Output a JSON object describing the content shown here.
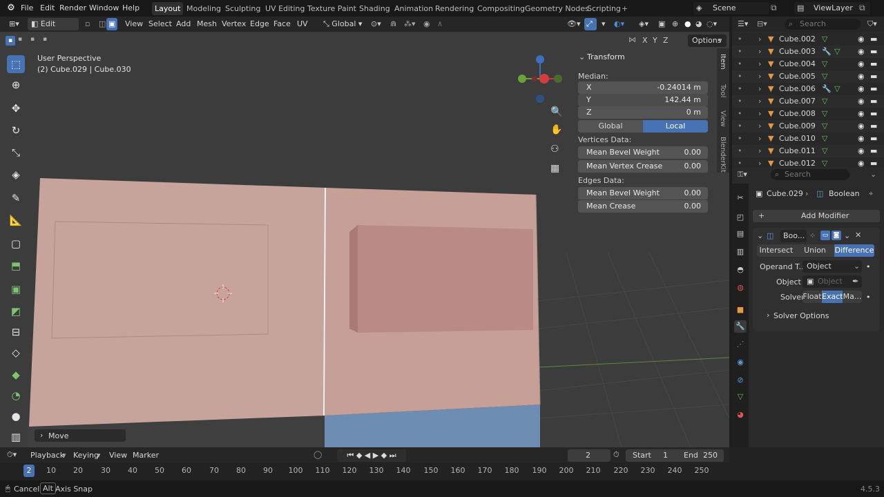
{
  "menu": {
    "items": [
      "File",
      "Edit",
      "Render",
      "Window",
      "Help"
    ],
    "workspaces": [
      "Layout",
      "Modeling",
      "Sculpting",
      "UV Editing",
      "Texture Paint",
      "Shading",
      "Animation",
      "Rendering",
      "Compositing",
      "Geometry Nodes",
      "Scripting"
    ],
    "active_workspace": "Layout",
    "scene": "Scene",
    "view_layer": "ViewLayer"
  },
  "header3d": {
    "mode": "Edit Mode",
    "menus": [
      "View",
      "Select",
      "Add",
      "Mesh",
      "Vertex",
      "Edge",
      "Face",
      "UV"
    ],
    "orientation": "Global",
    "options_label": "Options",
    "axes": [
      "X",
      "Y",
      "Z"
    ]
  },
  "viewport": {
    "perspective": "User Perspective",
    "object_info": "(2) Cube.029 | Cube.030",
    "operator_panel": "Move"
  },
  "npanel": {
    "section": "Transform",
    "median_label": "Median:",
    "x_label": "X",
    "x_value": "-0.24014 m",
    "y_label": "Y",
    "y_value": "142.44 m",
    "z_label": "Z",
    "z_value": "0 m",
    "global_btn": "Global",
    "local_btn": "Local",
    "vertices_data": "Vertices Data:",
    "mean_bevel_weight_v": "Mean Bevel Weight",
    "mean_bevel_weight_v_val": "0.00",
    "mean_vertex_crease": "Mean Vertex Crease",
    "mean_vertex_crease_val": "0.00",
    "edges_data": "Edges Data:",
    "mean_bevel_weight_e": "Mean Bevel Weight",
    "mean_bevel_weight_e_val": "0.00",
    "mean_crease": "Mean Crease",
    "mean_crease_val": "0.00",
    "tabs": [
      "Item",
      "Tool",
      "View",
      "BlenderKit"
    ]
  },
  "outliner": {
    "search_placeholder": "Search",
    "items": [
      "Cube.002",
      "Cube.003",
      "Cube.004",
      "Cube.005",
      "Cube.006",
      "Cube.007",
      "Cube.008",
      "Cube.009",
      "Cube.010",
      "Cube.011",
      "Cube.012"
    ]
  },
  "properties": {
    "search_placeholder": "Search",
    "object_name": "Cube.029",
    "modifier_crumb": "Boolean",
    "add_modifier": "Add Modifier",
    "modifier_name": "Boo...",
    "ops": [
      "Intersect",
      "Union",
      "Difference"
    ],
    "active_op": "Difference",
    "operand_label": "Operand T...",
    "operand_value": "Object",
    "object_label": "Object",
    "object_placeholder": "Object",
    "solver_label": "Solver",
    "solver_opts": [
      "Float",
      "Exact",
      "Ma..."
    ],
    "active_solver": "Exact",
    "solver_options": "Solver Options"
  },
  "timeline": {
    "menus": [
      "Playback",
      "Keying",
      "View",
      "Marker"
    ],
    "current_frame": "2",
    "start_label": "Start",
    "start": "1",
    "end_label": "End",
    "end": "250",
    "ruler": [
      "2",
      "10",
      "20",
      "30",
      "40",
      "50",
      "60",
      "70",
      "80",
      "90",
      "100",
      "110",
      "120",
      "130",
      "140",
      "150",
      "160",
      "170",
      "180",
      "190",
      "200",
      "210",
      "220",
      "230",
      "240",
      "250"
    ]
  },
  "status": {
    "cancel": "Cancel",
    "alt_key": "Alt",
    "axis_snap": "Axis Snap",
    "version": "4.5.3"
  }
}
